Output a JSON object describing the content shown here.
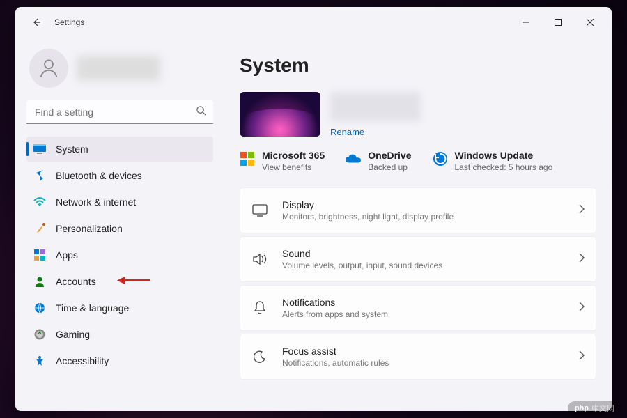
{
  "window": {
    "title": "Settings"
  },
  "search": {
    "placeholder": "Find a setting"
  },
  "sidebar": {
    "items": [
      {
        "key": "system",
        "label": "System"
      },
      {
        "key": "bluetooth",
        "label": "Bluetooth & devices"
      },
      {
        "key": "network",
        "label": "Network & internet"
      },
      {
        "key": "personalization",
        "label": "Personalization"
      },
      {
        "key": "apps",
        "label": "Apps"
      },
      {
        "key": "accounts",
        "label": "Accounts"
      },
      {
        "key": "time",
        "label": "Time & language"
      },
      {
        "key": "gaming",
        "label": "Gaming"
      },
      {
        "key": "accessibility",
        "label": "Accessibility"
      }
    ]
  },
  "page": {
    "title": "System",
    "rename": "Rename",
    "quick": {
      "m365": {
        "title": "Microsoft 365",
        "sub": "View benefits"
      },
      "onedrive": {
        "title": "OneDrive",
        "sub": "Backed up"
      },
      "update": {
        "title": "Windows Update",
        "sub": "Last checked: 5 hours ago"
      }
    },
    "cards": [
      {
        "key": "display",
        "title": "Display",
        "sub": "Monitors, brightness, night light, display profile"
      },
      {
        "key": "sound",
        "title": "Sound",
        "sub": "Volume levels, output, input, sound devices"
      },
      {
        "key": "notifications",
        "title": "Notifications",
        "sub": "Alerts from apps and system"
      },
      {
        "key": "focus",
        "title": "Focus assist",
        "sub": "Notifications, automatic rules"
      }
    ]
  },
  "watermark": {
    "brand": "php",
    "text": "中文网"
  }
}
